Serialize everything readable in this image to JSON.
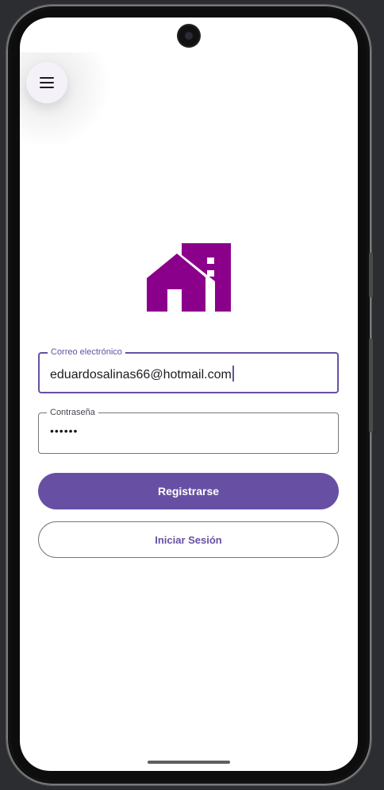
{
  "menu": {
    "icon": "hamburger-menu-icon"
  },
  "logo": {
    "icon": "house-building-logo",
    "color": "#8b008b"
  },
  "form": {
    "email_label": "Correo electrónico",
    "email_value": "eduardosalinas66@hotmail.com",
    "password_label": "Contraseña",
    "password_value": "••••••"
  },
  "buttons": {
    "register_label": "Registrarse",
    "login_label": "Iniciar Sesión"
  },
  "colors": {
    "primary": "#6750a4",
    "logo": "#8b008b",
    "outline": "#79747e"
  }
}
